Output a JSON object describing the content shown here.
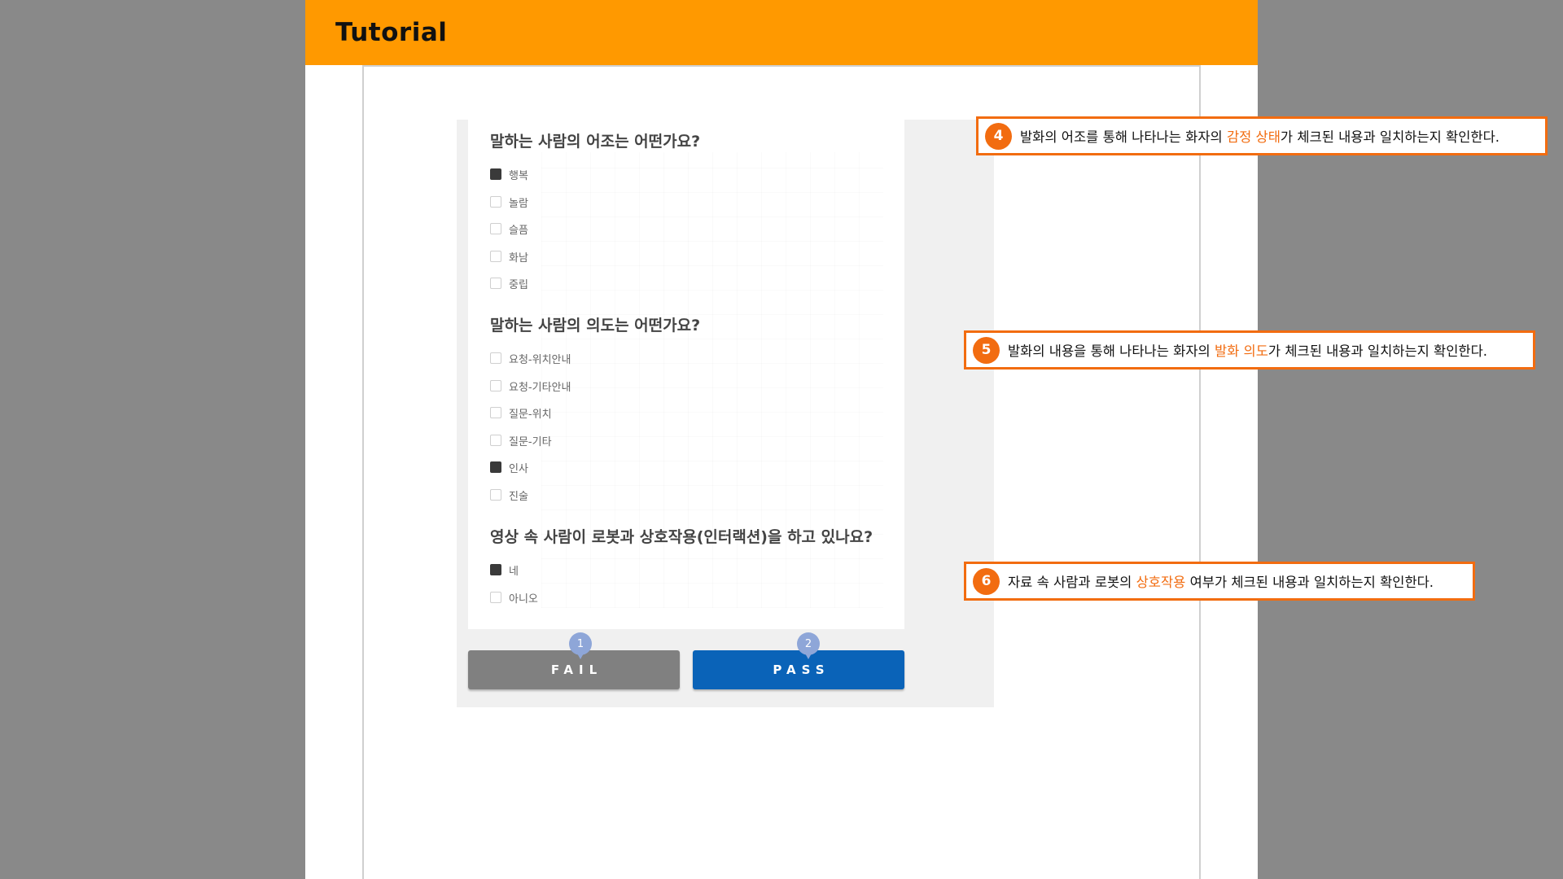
{
  "header": {
    "title": "Tutorial"
  },
  "form": {
    "q1": {
      "title": "말하는 사람의 어조는 어떤가요?",
      "options": [
        {
          "label": "행복",
          "checked": true
        },
        {
          "label": "놀람",
          "checked": false
        },
        {
          "label": "슬픔",
          "checked": false
        },
        {
          "label": "화남",
          "checked": false
        },
        {
          "label": "중립",
          "checked": false
        }
      ]
    },
    "q2": {
      "title": "말하는 사람의 의도는 어떤가요?",
      "options": [
        {
          "label": "요청-위치안내",
          "checked": false
        },
        {
          "label": "요청-기타안내",
          "checked": false
        },
        {
          "label": "질문-위치",
          "checked": false
        },
        {
          "label": "질문-기타",
          "checked": false
        },
        {
          "label": "인사",
          "checked": true
        },
        {
          "label": "진술",
          "checked": false
        }
      ]
    },
    "q3": {
      "title": "영상 속 사람이 로봇과 상호작용(인터랙션)을 하고 있나요?",
      "options": [
        {
          "label": "네",
          "checked": true
        },
        {
          "label": "아니오",
          "checked": false
        }
      ]
    },
    "fail_label": "FAIL",
    "pass_label": "PASS",
    "fail_marker": "1",
    "pass_marker": "2"
  },
  "callouts": [
    {
      "num": "4",
      "pre": "발화의 어조를 통해 나타나는 화자의 ",
      "highlight": "감정 상태",
      "post": "가 체크된 내용과 일치하는지 확인한다."
    },
    {
      "num": "5",
      "pre": "발화의 내용을 통해 나타나는 화자의 ",
      "highlight": "발화 의도",
      "post": "가 체크된 내용과 일치하는지 확인한다."
    },
    {
      "num": "6",
      "pre": "자료 속 사람과 로봇의 ",
      "highlight": "상호작용",
      "post": " 여부가 체크된 내용과 일치하는지 확인한다."
    }
  ],
  "colors": {
    "accent": "#ff9900",
    "callout": "#f26c10",
    "pass": "#0a63b8",
    "fail": "#808080"
  }
}
